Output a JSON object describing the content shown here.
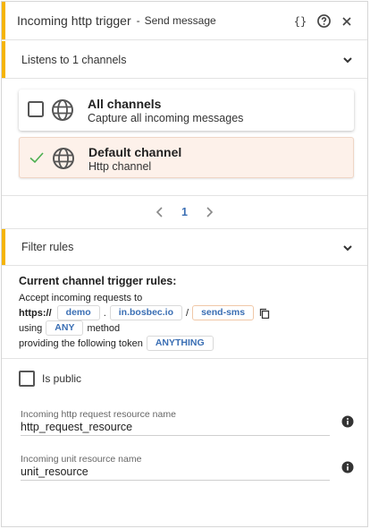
{
  "header": {
    "title": "Incoming http trigger",
    "separator": "-",
    "subtitle": "Send message",
    "json_icon_text": "{}"
  },
  "channels_section": {
    "label": "Listens to 1 channels",
    "items": [
      {
        "title": "All channels",
        "subtitle": "Capture all incoming messages",
        "selected": false
      },
      {
        "title": "Default channel",
        "subtitle": "Http channel",
        "selected": true
      }
    ],
    "pager": {
      "current_page": "1"
    }
  },
  "filter_section": {
    "label": "Filter rules",
    "rules_title": "Current channel trigger rules:",
    "accept_text": "Accept incoming requests to",
    "protocol": "https://",
    "subdomain": "demo",
    "dot": ".",
    "domain": "in.bosbec.io",
    "slash": "/",
    "path": "send-sms",
    "using_text": "using",
    "method": "ANY",
    "method_text": "method",
    "token_text": "providing the following token",
    "token": "ANYTHING"
  },
  "settings": {
    "is_public_label": "Is public",
    "is_public_checked": false,
    "http_resource_label": "Incoming http request resource name",
    "http_resource_value": "http_request_resource",
    "unit_resource_label": "Incoming unit resource name",
    "unit_resource_value": "unit_resource"
  },
  "colors": {
    "accent": "#f5b400",
    "link": "#3b6fb4",
    "selected_card_bg": "#fdf1ea",
    "check_green": "#4caf50"
  }
}
